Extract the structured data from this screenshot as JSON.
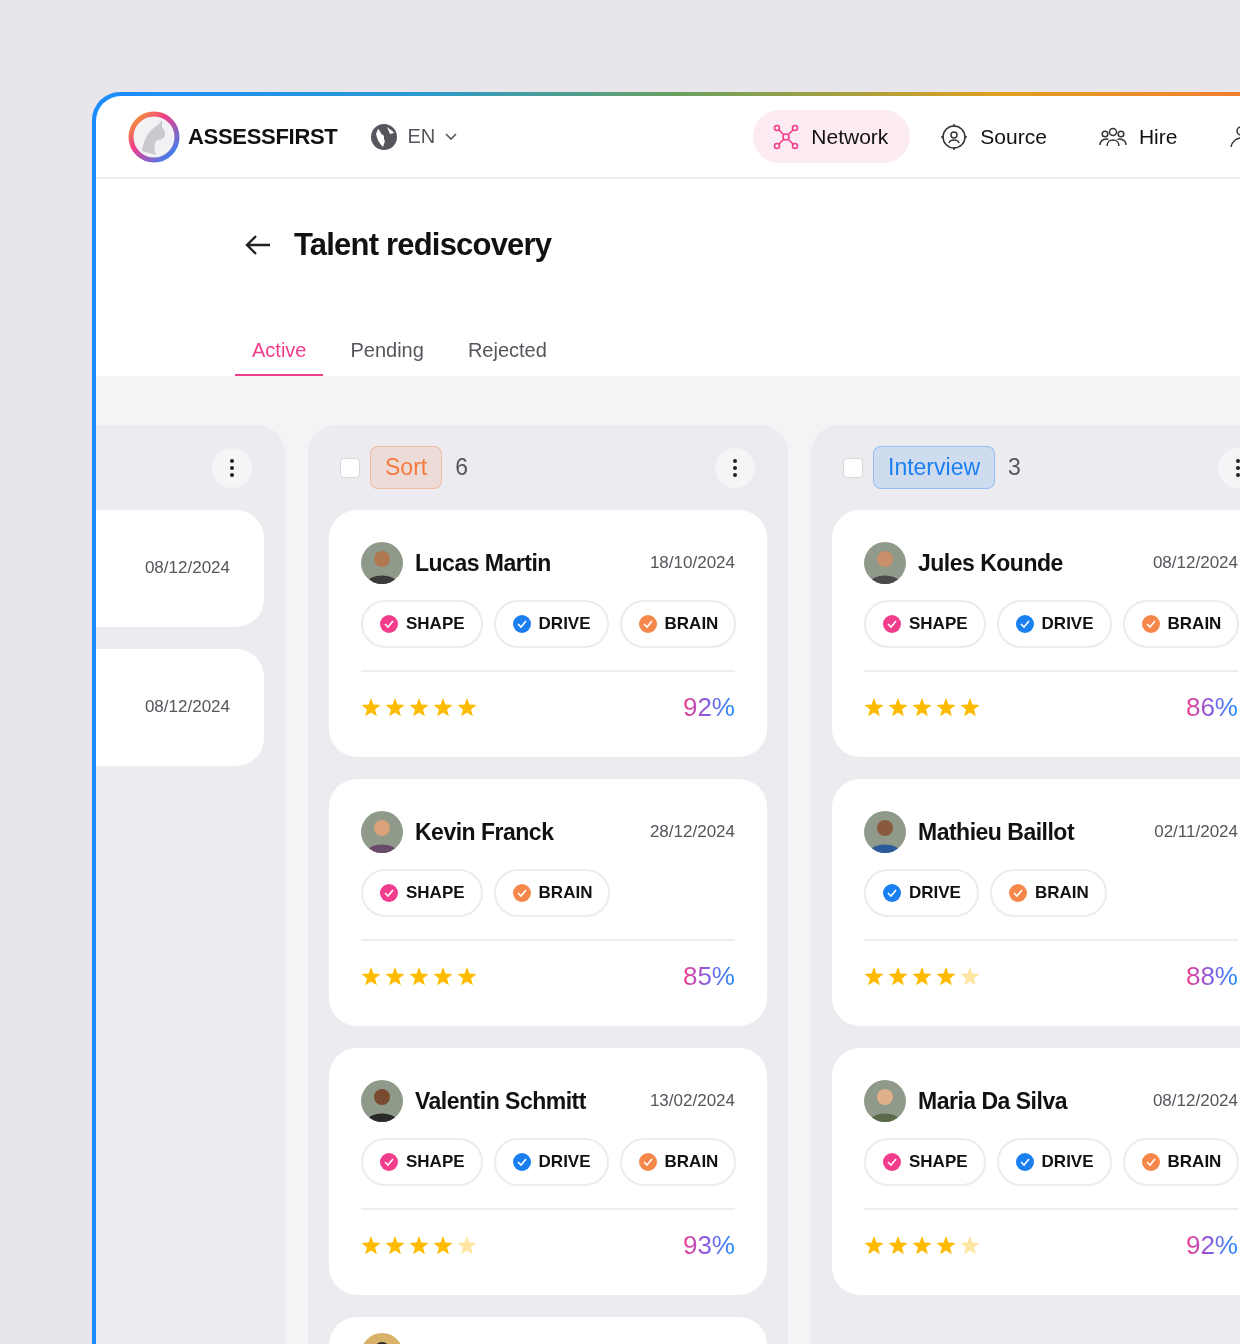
{
  "brand": {
    "name": "ASSESSFIRST"
  },
  "language": {
    "label": "EN"
  },
  "nav": [
    {
      "label": "Network",
      "selected": true
    },
    {
      "label": "Source",
      "selected": false
    },
    {
      "label": "Hire",
      "selected": false
    }
  ],
  "page_title": "Talent rediscovery",
  "tabs": [
    {
      "label": "Active",
      "selected": true
    },
    {
      "label": "Pending",
      "selected": false
    },
    {
      "label": "Rejected",
      "selected": false
    }
  ],
  "columns": [
    {
      "kind": "partial",
      "cards": [
        {
          "kind": "date_only",
          "date": "08/12/2024"
        },
        {
          "kind": "date_only",
          "date": "08/12/2024"
        }
      ]
    },
    {
      "kind": "full",
      "checked": false,
      "label": "Sort",
      "color": "#f47a3c",
      "count": "6",
      "cards": [
        {
          "kind": "full",
          "name": "Lucas Martin",
          "date": "18/10/2024",
          "tags": [
            {
              "label": "SHAPE",
              "color": "#f23d8c"
            },
            {
              "label": "DRIVE",
              "color": "#1a7ff0"
            },
            {
              "label": "BRAIN",
              "color": "#f5874a"
            }
          ],
          "stars": 5,
          "score": "92%"
        },
        {
          "kind": "full",
          "name": "Kevin Franck",
          "date": "28/12/2024",
          "tags": [
            {
              "label": "SHAPE",
              "color": "#f23d8c"
            },
            {
              "label": "BRAIN",
              "color": "#f5874a"
            }
          ],
          "stars": 5,
          "score": "85%"
        },
        {
          "kind": "full",
          "name": "Valentin Schmitt",
          "date": "13/02/2024",
          "tags": [
            {
              "label": "SHAPE",
              "color": "#f23d8c"
            },
            {
              "label": "DRIVE",
              "color": "#1a7ff0"
            },
            {
              "label": "BRAIN",
              "color": "#f5874a"
            }
          ],
          "stars": 4,
          "score": "93%"
        },
        {
          "kind": "cut"
        }
      ]
    },
    {
      "kind": "full",
      "checked": false,
      "label": "Interview",
      "color": "#1a7ff0",
      "count": "3",
      "cards": [
        {
          "kind": "full",
          "name": "Jules Kounde",
          "date": "08/12/2024",
          "tags": [
            {
              "label": "SHAPE",
              "color": "#f23d8c"
            },
            {
              "label": "DRIVE",
              "color": "#1a7ff0"
            },
            {
              "label": "BRAIN",
              "color": "#f5874a"
            }
          ],
          "stars": 5,
          "score": "86%"
        },
        {
          "kind": "full",
          "name": "Mathieu Baillot",
          "date": "02/11/2024",
          "tags": [
            {
              "label": "DRIVE",
              "color": "#1a7ff0"
            },
            {
              "label": "BRAIN",
              "color": "#f5874a"
            }
          ],
          "stars": 4,
          "score": "88%"
        },
        {
          "kind": "full",
          "name": "Maria Da Silva",
          "date": "08/12/2024",
          "tags": [
            {
              "label": "SHAPE",
              "color": "#f23d8c"
            },
            {
              "label": "DRIVE",
              "color": "#1a7ff0"
            },
            {
              "label": "BRAIN",
              "color": "#f5874a"
            }
          ],
          "stars": 4,
          "score": "92%"
        }
      ]
    }
  ]
}
